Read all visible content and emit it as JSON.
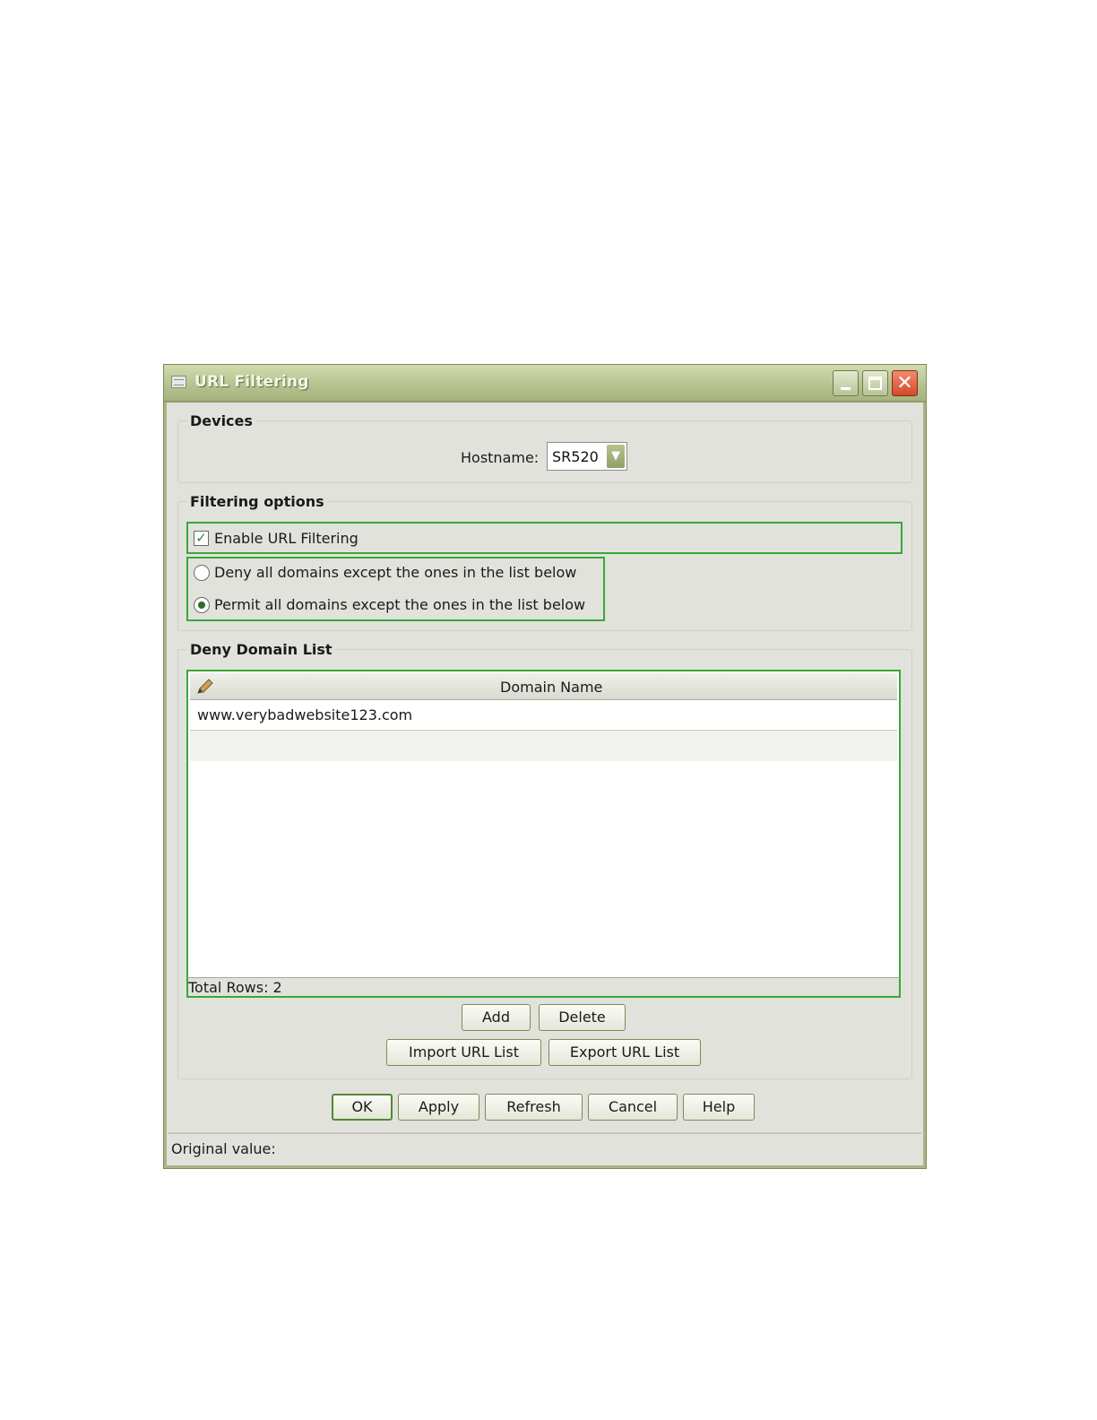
{
  "window": {
    "title": "URL Filtering"
  },
  "devices": {
    "group_title": "Devices",
    "hostname_label": "Hostname:",
    "hostname_value": "SR520"
  },
  "filtering": {
    "group_title": "Filtering options",
    "enable_label": "Enable URL Filtering",
    "enable_checked": true,
    "deny_all_label": "Deny all domains except the ones in the list below",
    "permit_all_label": "Permit all domains except the ones in the list below",
    "selected_mode": "permit_all"
  },
  "domain_list": {
    "group_title": "Deny Domain List",
    "column_header": "Domain Name",
    "rows": [
      "www.verybadwebsite123.com",
      ""
    ],
    "total_rows_label": "Total Rows: 2"
  },
  "list_buttons": {
    "add": "Add",
    "delete": "Delete",
    "import": "Import URL List",
    "export": "Export URL List"
  },
  "dialog_buttons": {
    "ok": "OK",
    "apply": "Apply",
    "refresh": "Refresh",
    "cancel": "Cancel",
    "help": "Help"
  },
  "status": {
    "original_value_label": "Original value:"
  },
  "colors": {
    "accent_green": "#39a739",
    "titlebar": "#b6c390",
    "close_button": "#d24a2a"
  }
}
